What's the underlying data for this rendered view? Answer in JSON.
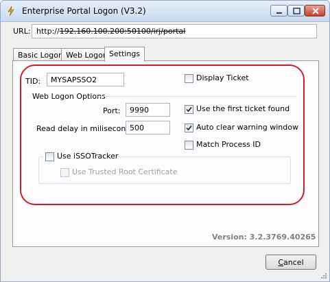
{
  "window": {
    "title": "Enterprise Portal Logon (V3.2)",
    "icons": {
      "app": "lightning-app-icon",
      "minimize": "minimize-icon",
      "maximize": "maximize-icon",
      "close": "close-icon"
    }
  },
  "url": {
    "label": "URL:",
    "prefix": "http://",
    "struck": "192.160.100.200:50100/irj/portal"
  },
  "tabs": [
    {
      "label": "Basic Logon",
      "active": false
    },
    {
      "label": "Web Logon",
      "active": false
    },
    {
      "label": "Settings",
      "active": true
    }
  ],
  "settings": {
    "tid_label": "TID:",
    "tid_value": "MYSAPSSO2",
    "display_ticket": {
      "label": "Display Ticket",
      "checked": false
    },
    "web_logon_options_label": "Web Logon Options",
    "port_label": "Port:",
    "port_value": "9990",
    "read_delay_label": "Read delay in milisecond:",
    "read_delay_value": "500",
    "use_first_ticket": {
      "label": "Use the first ticket found",
      "checked": true
    },
    "auto_clear": {
      "label": "Auto clear warning window",
      "checked": true
    },
    "match_process": {
      "label": "Match Process ID",
      "checked": false
    },
    "use_isso_tracker": {
      "label": "Use iSSOTracker",
      "checked": false
    },
    "trusted_root": {
      "label": "Use Trusted Root Certificate",
      "checked": false,
      "disabled": true
    }
  },
  "version": "Version: 3.2.3769.40265",
  "cancel": {
    "accel": "C",
    "rest": "ancel"
  },
  "colors": {
    "highlight_outline": "#c81e2a",
    "titlebar": "#c9daf0"
  }
}
